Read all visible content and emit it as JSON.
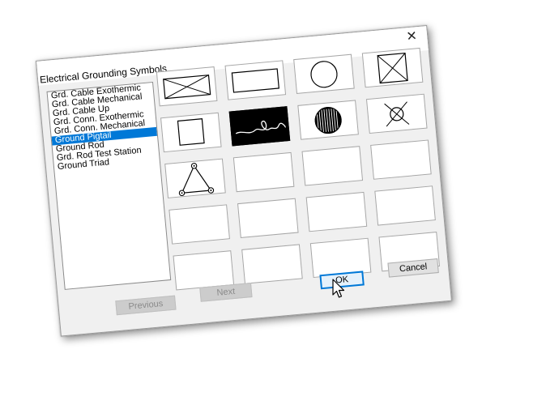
{
  "dialog": {
    "title": "Electrical Grounding Symbols",
    "close_icon": "close-icon"
  },
  "symbol_list": {
    "items": [
      {
        "label": "Grd. Cable Exothermic"
      },
      {
        "label": "Grd. Cable Mechanical"
      },
      {
        "label": "Grd. Cable Up"
      },
      {
        "label": "Grd. Conn. Exothermic"
      },
      {
        "label": "Grd. Conn. Mechanical"
      },
      {
        "label": "Ground Pigtail",
        "selected": true
      },
      {
        "label": "Ground Rod"
      },
      {
        "label": "Grd. Rod Test Station"
      },
      {
        "label": "Ground Triad"
      }
    ]
  },
  "symbol_grid": {
    "columns": 4,
    "rows": 5,
    "cells": [
      {
        "icon": "boxed-x-wide-icon"
      },
      {
        "icon": "rectangle-icon"
      },
      {
        "icon": "circle-icon"
      },
      {
        "icon": "boxed-x-square-icon"
      },
      {
        "icon": "square-icon"
      },
      {
        "icon": "pigtail-icon",
        "selected": true
      },
      {
        "icon": "hatched-circle-icon"
      },
      {
        "icon": "circle-x-icon"
      },
      {
        "icon": "triad-icon"
      },
      {
        "icon": ""
      },
      {
        "icon": ""
      },
      {
        "icon": ""
      },
      {
        "icon": ""
      },
      {
        "icon": ""
      },
      {
        "icon": ""
      },
      {
        "icon": ""
      },
      {
        "icon": ""
      },
      {
        "icon": ""
      },
      {
        "icon": ""
      },
      {
        "icon": ""
      }
    ]
  },
  "buttons": {
    "previous_label": "Previous",
    "next_label": "Next",
    "ok_label": "OK",
    "cancel_label": "Cancel"
  },
  "colors": {
    "selection": "#0078d7"
  }
}
